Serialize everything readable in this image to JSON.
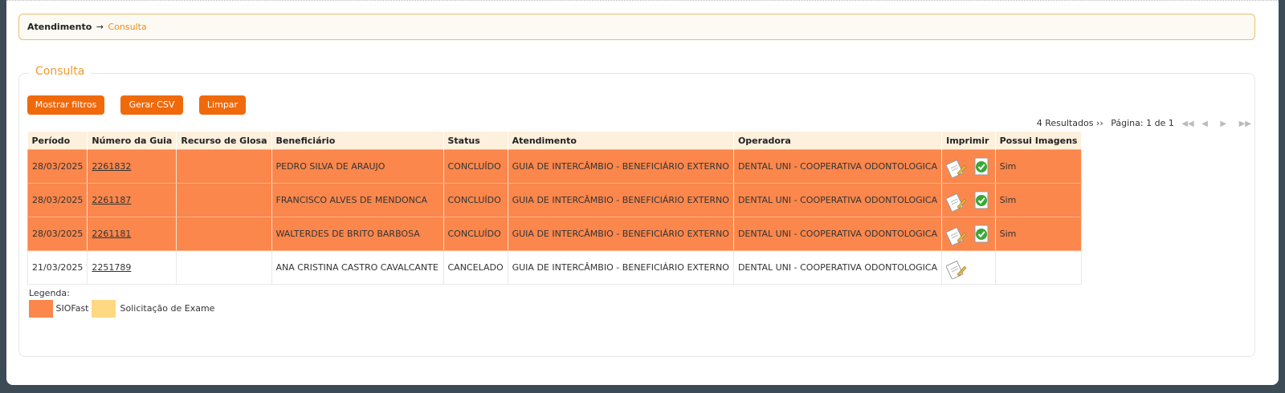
{
  "breadcrumb": {
    "root": "Atendimento",
    "arrow": "→",
    "current": "Consulta"
  },
  "section": {
    "title": "Consulta"
  },
  "buttons": {
    "filters": "Mostrar filtros",
    "csv": "Gerar CSV",
    "clear": "Limpar"
  },
  "pager": {
    "results": "4 Resultados ››",
    "page": "Página: 1 de 1"
  },
  "table": {
    "headers": [
      "Período",
      "Número da Guia",
      "Recurso de Glosa",
      "Beneficiário",
      "Status",
      "Atendimento",
      "Operadora",
      "Imprimir",
      "Possui Imagens"
    ],
    "rows": [
      {
        "periodo": "28/03/2025",
        "guia": "2261832",
        "recurso": "",
        "beneficiario": "PEDRO SILVA DE ARAUJO",
        "status": "CONCLUÍDO",
        "atendimento": "GUIA DE INTERCÂMBIO - BENEFICIÁRIO EXTERNO",
        "operadora": "DENTAL UNI - COOPERATIVA ODONTOLOGICA",
        "imagens": "Sim"
      },
      {
        "periodo": "28/03/2025",
        "guia": "2261187",
        "recurso": "",
        "beneficiario": "FRANCISCO ALVES DE MENDONCA",
        "status": "CONCLUÍDO",
        "atendimento": "GUIA DE INTERCÂMBIO - BENEFICIÁRIO EXTERNO",
        "operadora": "DENTAL UNI - COOPERATIVA ODONTOLOGICA",
        "imagens": "Sim"
      },
      {
        "periodo": "28/03/2025",
        "guia": "2261181",
        "recurso": "",
        "beneficiario": "WALTERDES DE BRITO BARBOSA",
        "status": "CONCLUÍDO",
        "atendimento": "GUIA DE INTERCÂMBIO - BENEFICIÁRIO EXTERNO",
        "operadora": "DENTAL UNI - COOPERATIVA ODONTOLOGICA",
        "imagens": "Sim"
      },
      {
        "periodo": "21/03/2025",
        "guia": "2251789",
        "recurso": "",
        "beneficiario": "ANA CRISTINA CASTRO CAVALCANTE",
        "status": "CANCELADO",
        "atendimento": "GUIA DE INTERCÂMBIO - BENEFICIÁRIO EXTERNO",
        "operadora": "DENTAL UNI - COOPERATIVA ODONTOLOGICA",
        "imagens": ""
      }
    ]
  },
  "legend": {
    "title": "Legenda:",
    "sio": "SIOFast",
    "exame": "Solicitação de Exame"
  },
  "colors": {
    "sio": "#fb874c",
    "exame": "#fed982",
    "accent": "#f06a0c"
  },
  "icons": {
    "print": "print-document-icon",
    "check": "check-document-icon"
  }
}
